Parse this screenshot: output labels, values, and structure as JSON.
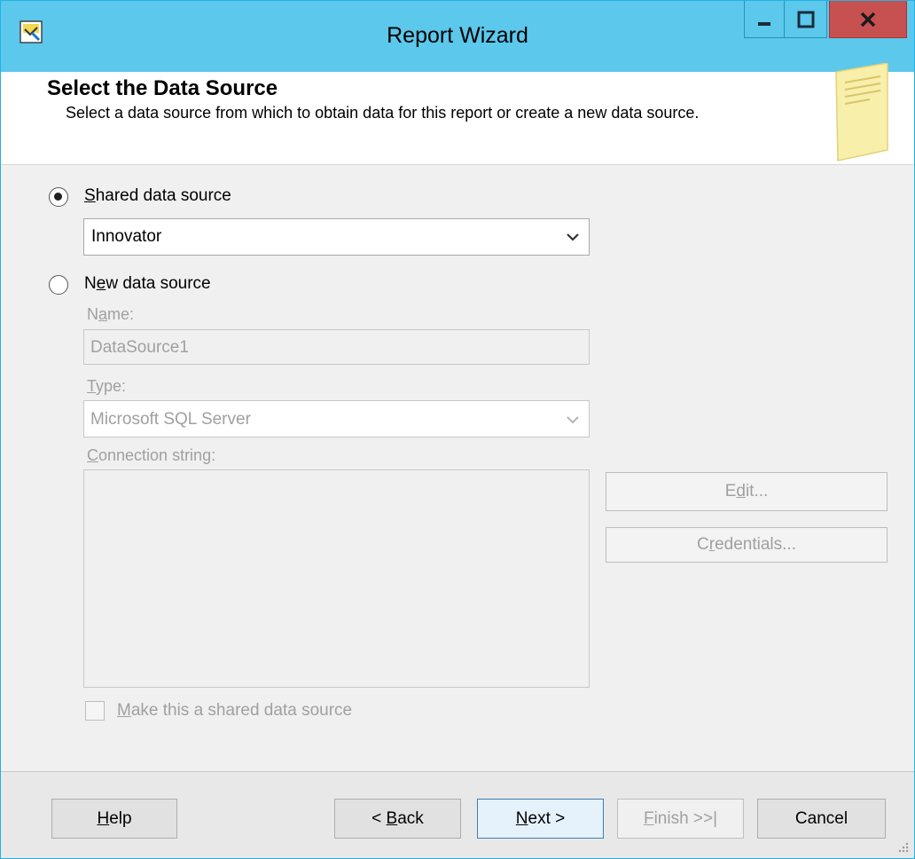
{
  "window": {
    "title": "Report Wizard"
  },
  "header": {
    "title": "Select the Data Source",
    "description": "Select a data source from which to obtain data for this report or create a new data source."
  },
  "shared": {
    "label_u": "S",
    "label_rest": "hared data source",
    "selected": "Innovator",
    "checked": true
  },
  "newsource": {
    "label_first": "N",
    "label_u": "e",
    "label_rest": "w data source",
    "checked": false,
    "name_label_first": "N",
    "name_label_u": "a",
    "name_label_rest": "me:",
    "name_value": "DataSource1",
    "type_label_u": "T",
    "type_label_rest": "ype:",
    "type_value": "Microsoft SQL Server",
    "conn_label_u": "C",
    "conn_label_rest": "onnection string:",
    "conn_value": "",
    "edit_first": "E",
    "edit_u": "d",
    "edit_rest": "it...",
    "cred_first": "C",
    "cred_u": "r",
    "cred_rest": "edentials...",
    "make_shared_u": "M",
    "make_shared_rest": "ake this a shared data source"
  },
  "footer": {
    "help_u": "H",
    "help_rest": "elp",
    "back_first": "< ",
    "back_u": "B",
    "back_rest": "ack",
    "next_u": "N",
    "next_rest": "ext >",
    "finish_u": "F",
    "finish_rest": "inish >>|",
    "cancel": "Cancel"
  },
  "colors": {
    "titlebar": "#5bc8ec",
    "close_button": "#c75050",
    "disabled_text": "#a0a0a0"
  }
}
